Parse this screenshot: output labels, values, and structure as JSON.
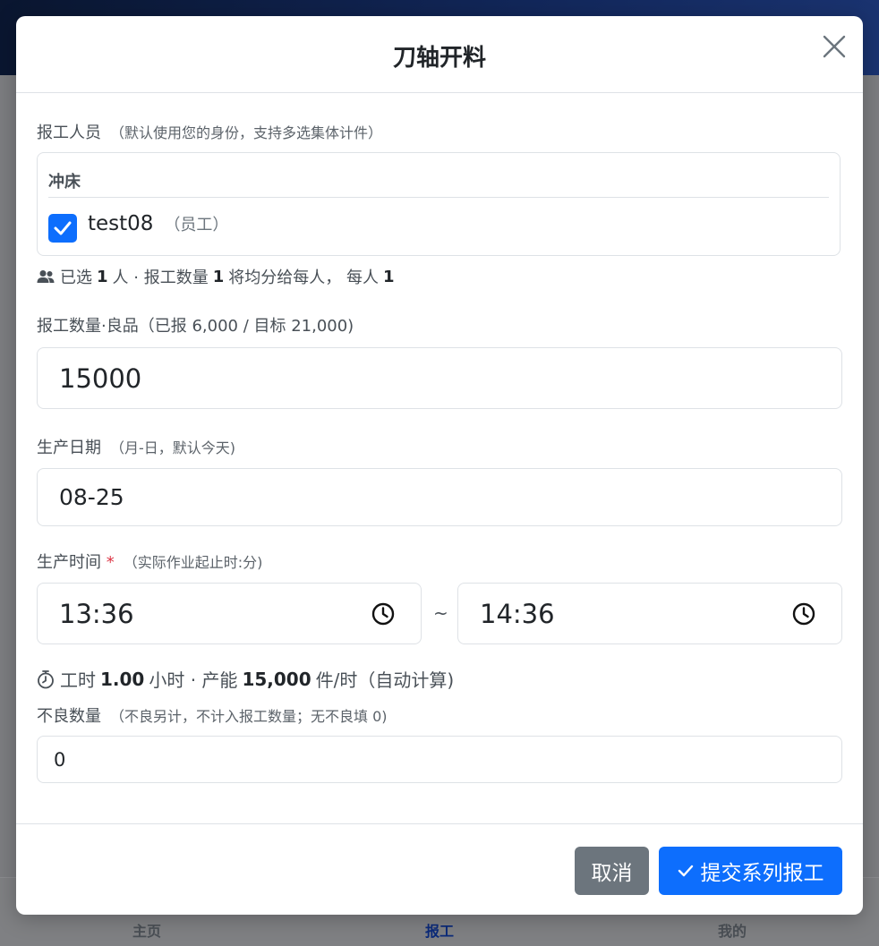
{
  "background": {
    "bottom_nav": {
      "home": "主页",
      "report": "报工",
      "mine": "我的"
    }
  },
  "modal": {
    "title": "刀轴开料",
    "staff": {
      "label": "报工人员",
      "hint": "（默认使用您的身份，支持多选集体计件）",
      "group_name": "冲床",
      "members": [
        {
          "name": "test08",
          "role": "（员工）",
          "checked": true
        }
      ],
      "summary": {
        "prefix": "已选",
        "count": "1",
        "mid1": "人 · 报工数量",
        "qty": "1",
        "mid2": "将均分给每人， 每人",
        "per": "1"
      }
    },
    "quantity": {
      "label": "报工数量·良品（已报 6,000 / 目标 21,000)",
      "value": "15000"
    },
    "date": {
      "label": "生产日期",
      "hint": "（月-日，默认今天)",
      "value": "08-25"
    },
    "time": {
      "label": "生产时间",
      "required": "*",
      "hint": "（实际作业起止时:分)",
      "start": "13:36",
      "separator": "~",
      "end": "14:36",
      "calc": {
        "prefix": "工时",
        "hours": "1.00",
        "mid": "小时 · 产能",
        "capacity": "15,000",
        "suffix": "件/时（自动计算)"
      }
    },
    "defects": {
      "label": "不良数量",
      "hint": "（不良另计，不计入报工数量；无不良填 0)",
      "value": "0"
    },
    "buttons": {
      "cancel": "取消",
      "submit": "提交系列报工"
    }
  },
  "colors": {
    "primary": "#0d6efd",
    "secondary": "#6c757d",
    "danger": "#dc3545",
    "header_dark": "#0a1630"
  }
}
